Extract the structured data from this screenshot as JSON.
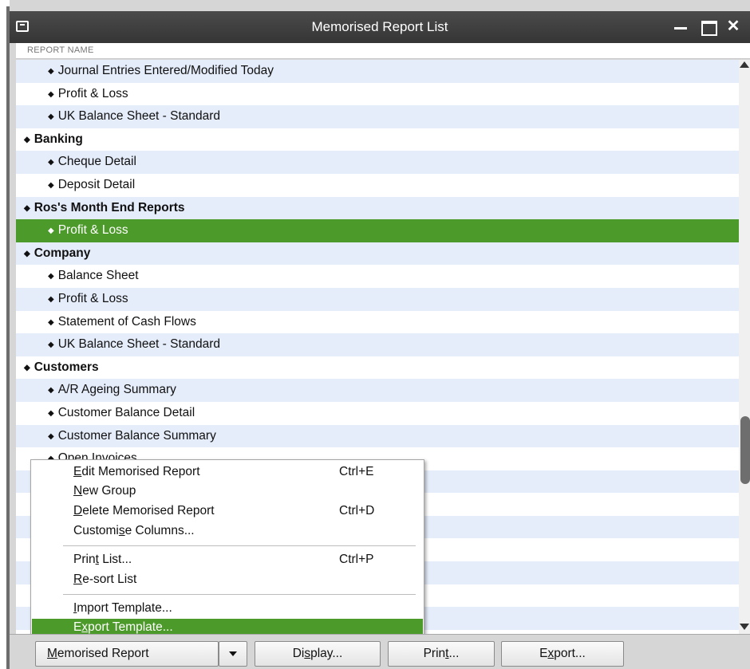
{
  "window": {
    "title": "Memorised Report List",
    "close_glyph": "✕"
  },
  "column_header": "REPORT NAME",
  "rows": [
    {
      "label": "Journal Entries Entered/Modified Today",
      "level": 1
    },
    {
      "label": "Profit & Loss",
      "level": 1
    },
    {
      "label": "UK Balance Sheet - Standard",
      "level": 1
    },
    {
      "label": "Banking",
      "level": 0
    },
    {
      "label": "Cheque Detail",
      "level": 1
    },
    {
      "label": "Deposit Detail",
      "level": 1
    },
    {
      "label": "Ros's Month End Reports",
      "level": 0
    },
    {
      "label": "Profit & Loss",
      "level": 1,
      "selected": true
    },
    {
      "label": "Company",
      "level": 0
    },
    {
      "label": "Balance Sheet",
      "level": 1
    },
    {
      "label": "Profit & Loss",
      "level": 1
    },
    {
      "label": "Statement of Cash Flows",
      "level": 1
    },
    {
      "label": "UK Balance Sheet - Standard",
      "level": 1
    },
    {
      "label": "Customers",
      "level": 0
    },
    {
      "label": "A/R Ageing Summary",
      "level": 1
    },
    {
      "label": "Customer Balance Detail",
      "level": 1
    },
    {
      "label": "Customer Balance Summary",
      "level": 1
    },
    {
      "label": "Open Invoices",
      "level": 1
    },
    {
      "label": "",
      "level": 0
    },
    {
      "label": "",
      "level": 1
    },
    {
      "label": "",
      "level": 1
    },
    {
      "label": "",
      "level": 1
    },
    {
      "label": "",
      "level": 0
    },
    {
      "label": "",
      "level": 1
    },
    {
      "label": "",
      "level": 1
    },
    {
      "label": "",
      "level": 1
    }
  ],
  "context_menu": {
    "edit": {
      "pre": "",
      "key": "E",
      "post": "dit Memorised Report",
      "shortcut": "Ctrl+E"
    },
    "new_group": {
      "pre": "",
      "key": "N",
      "post": "ew Group"
    },
    "delete": {
      "pre": "",
      "key": "D",
      "post": "elete Memorised Report",
      "shortcut": "Ctrl+D"
    },
    "customise": {
      "pre": "Customi",
      "key": "s",
      "post": "e Columns..."
    },
    "print_list": {
      "pre": "Prin",
      "key": "t",
      "post": " List...",
      "shortcut": "Ctrl+P"
    },
    "resort": {
      "pre": "",
      "key": "R",
      "post": "e-sort List"
    },
    "import": {
      "pre": "",
      "key": "I",
      "post": "mport Template..."
    },
    "export": {
      "pre": "E",
      "key": "x",
      "post": "port Template..."
    }
  },
  "buttons": {
    "memorised": {
      "pre": "",
      "key": "M",
      "post": "emorised Report"
    },
    "display": {
      "pre": "Di",
      "key": "s",
      "post": "play..."
    },
    "print": {
      "pre": "Prin",
      "key": "t",
      "post": "..."
    },
    "export": {
      "pre": "E",
      "key": "x",
      "post": "port..."
    }
  },
  "colors": {
    "selection": "#4c9a2a",
    "alt_row": "#e5ecfa",
    "titlebar": "#3d3d3d"
  },
  "icons": {
    "bullet": "diamond-bullet",
    "dropdown": "caret-down"
  }
}
